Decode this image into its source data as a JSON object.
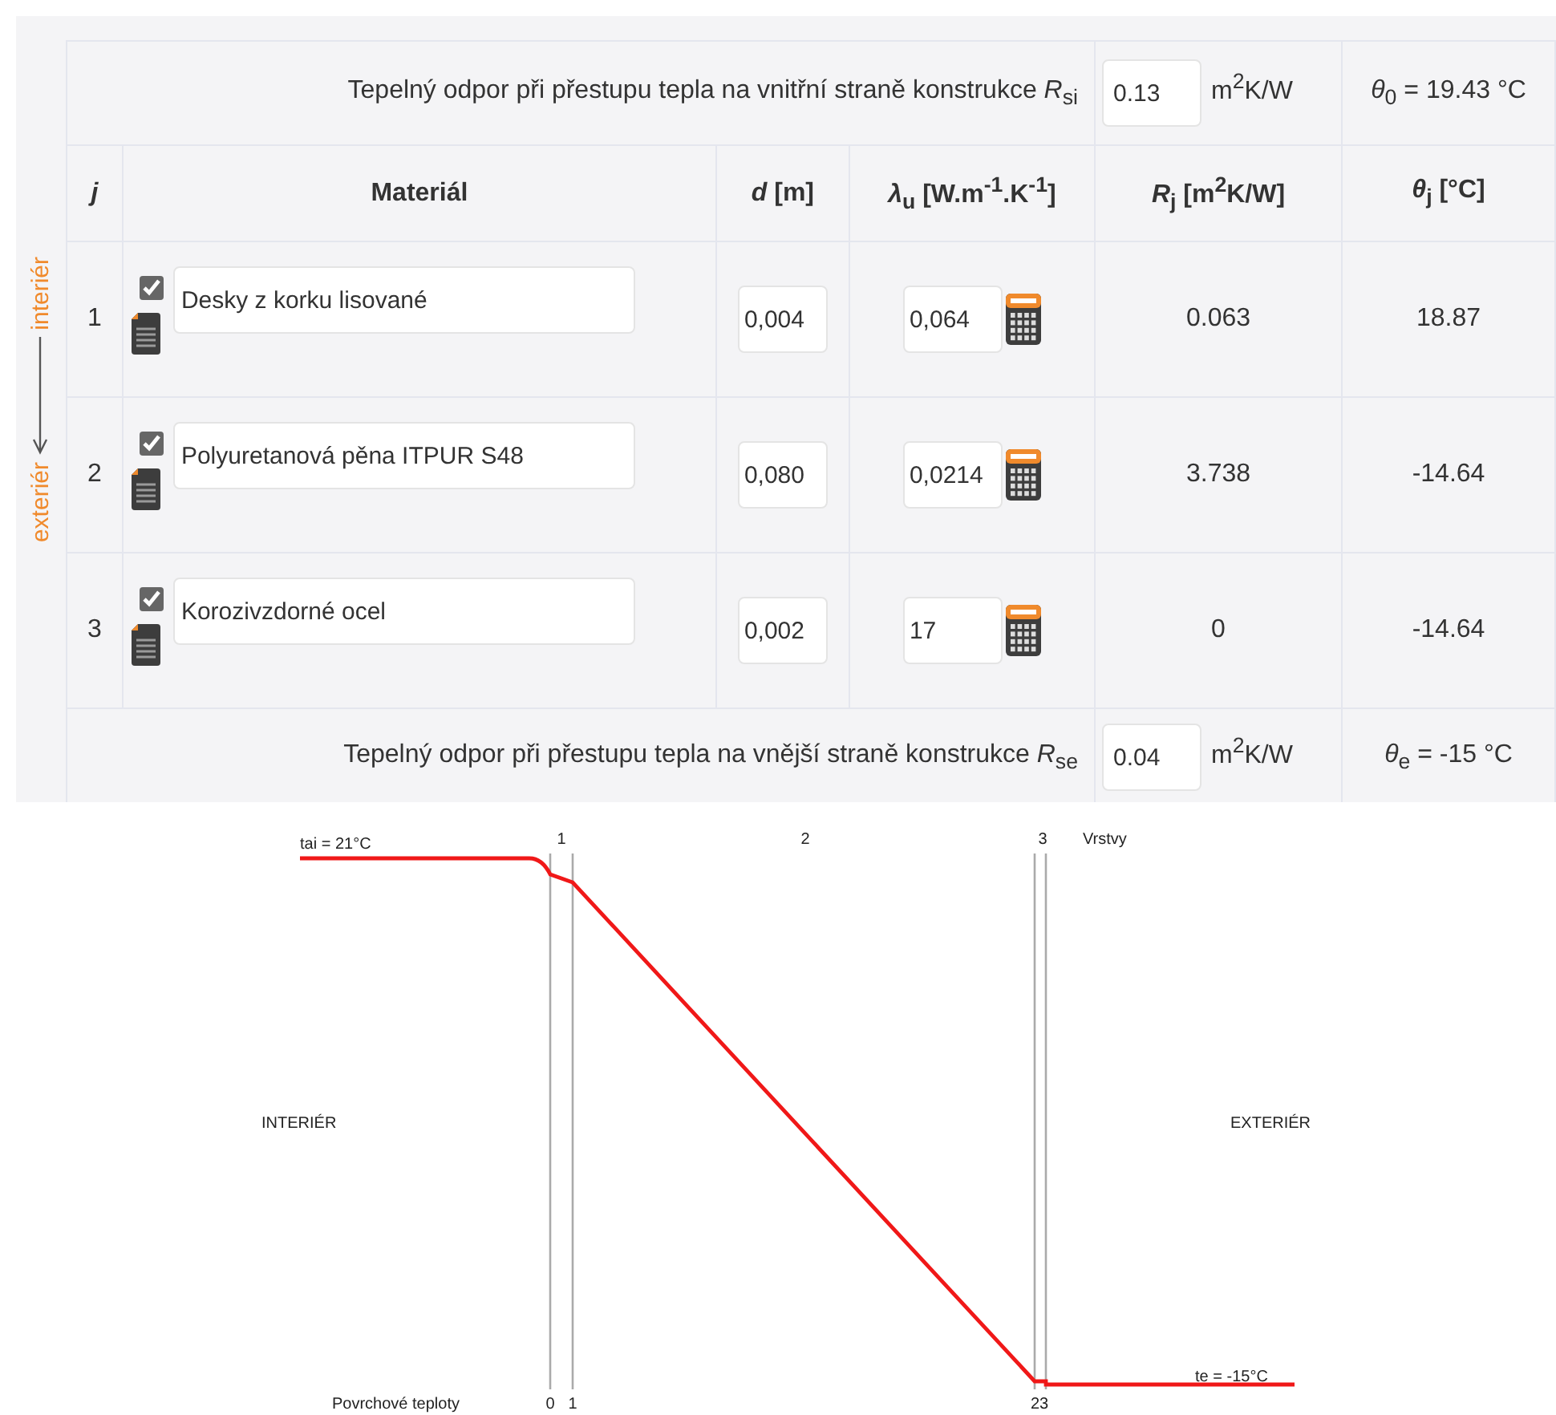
{
  "side_labels": {
    "interior": "interiér",
    "exterior": "exteriér"
  },
  "inner_surface": {
    "label": "Tepelný odpor při přestupu tepla na vnitřní straně konstrukce *R*$_{si}$",
    "value": "0.13",
    "unit": "m$^{2}$K/W",
    "result": "*θ*$_{0}$ = 19.43 °C"
  },
  "columns": [
    "*j*",
    "Materiál",
    "*d* [m]",
    "*λ*$_{u}$ [W.m$^{-1}$.K$^{-1}$]",
    "*R*$_{j}$ [m$^{2}$K/W]",
    "*θ*$_{j}$ [°C]"
  ],
  "layers": [
    {
      "j": "1",
      "checked": true,
      "material": "Desky z korku lisované",
      "d": "0,004",
      "lambda": "0,064",
      "r": "0.063",
      "theta": "18.87"
    },
    {
      "j": "2",
      "checked": true,
      "material": "Polyuretanová pěna ITPUR S48",
      "d": "0,080",
      "lambda": "0,0214",
      "r": "3.738",
      "theta": "-14.64"
    },
    {
      "j": "3",
      "checked": true,
      "material": "Korozivzdorné ocel",
      "d": "0,002",
      "lambda": "17",
      "r": "0",
      "theta": "-14.64"
    }
  ],
  "outer_surface": {
    "label": "Tepelný odpor při přestupu tepla na vnější straně konstrukce *R*$_{se}$",
    "value": "0.04",
    "unit": "m$^{2}$K/W",
    "result": "*θ*$_{e}$ = -15 °C"
  },
  "diagram": {
    "inner_temp": "tai = 21°C",
    "layer_labels": [
      "1",
      "2",
      "3"
    ],
    "layers_caption": "Vrstvy",
    "interior": "INTERIÉR",
    "exterior": "EXTERIÉR",
    "surface_caption": "Povrchové teploty",
    "surface_labels": [
      "0",
      "1",
      "23"
    ],
    "outer_temp": "te = -15°C"
  }
}
